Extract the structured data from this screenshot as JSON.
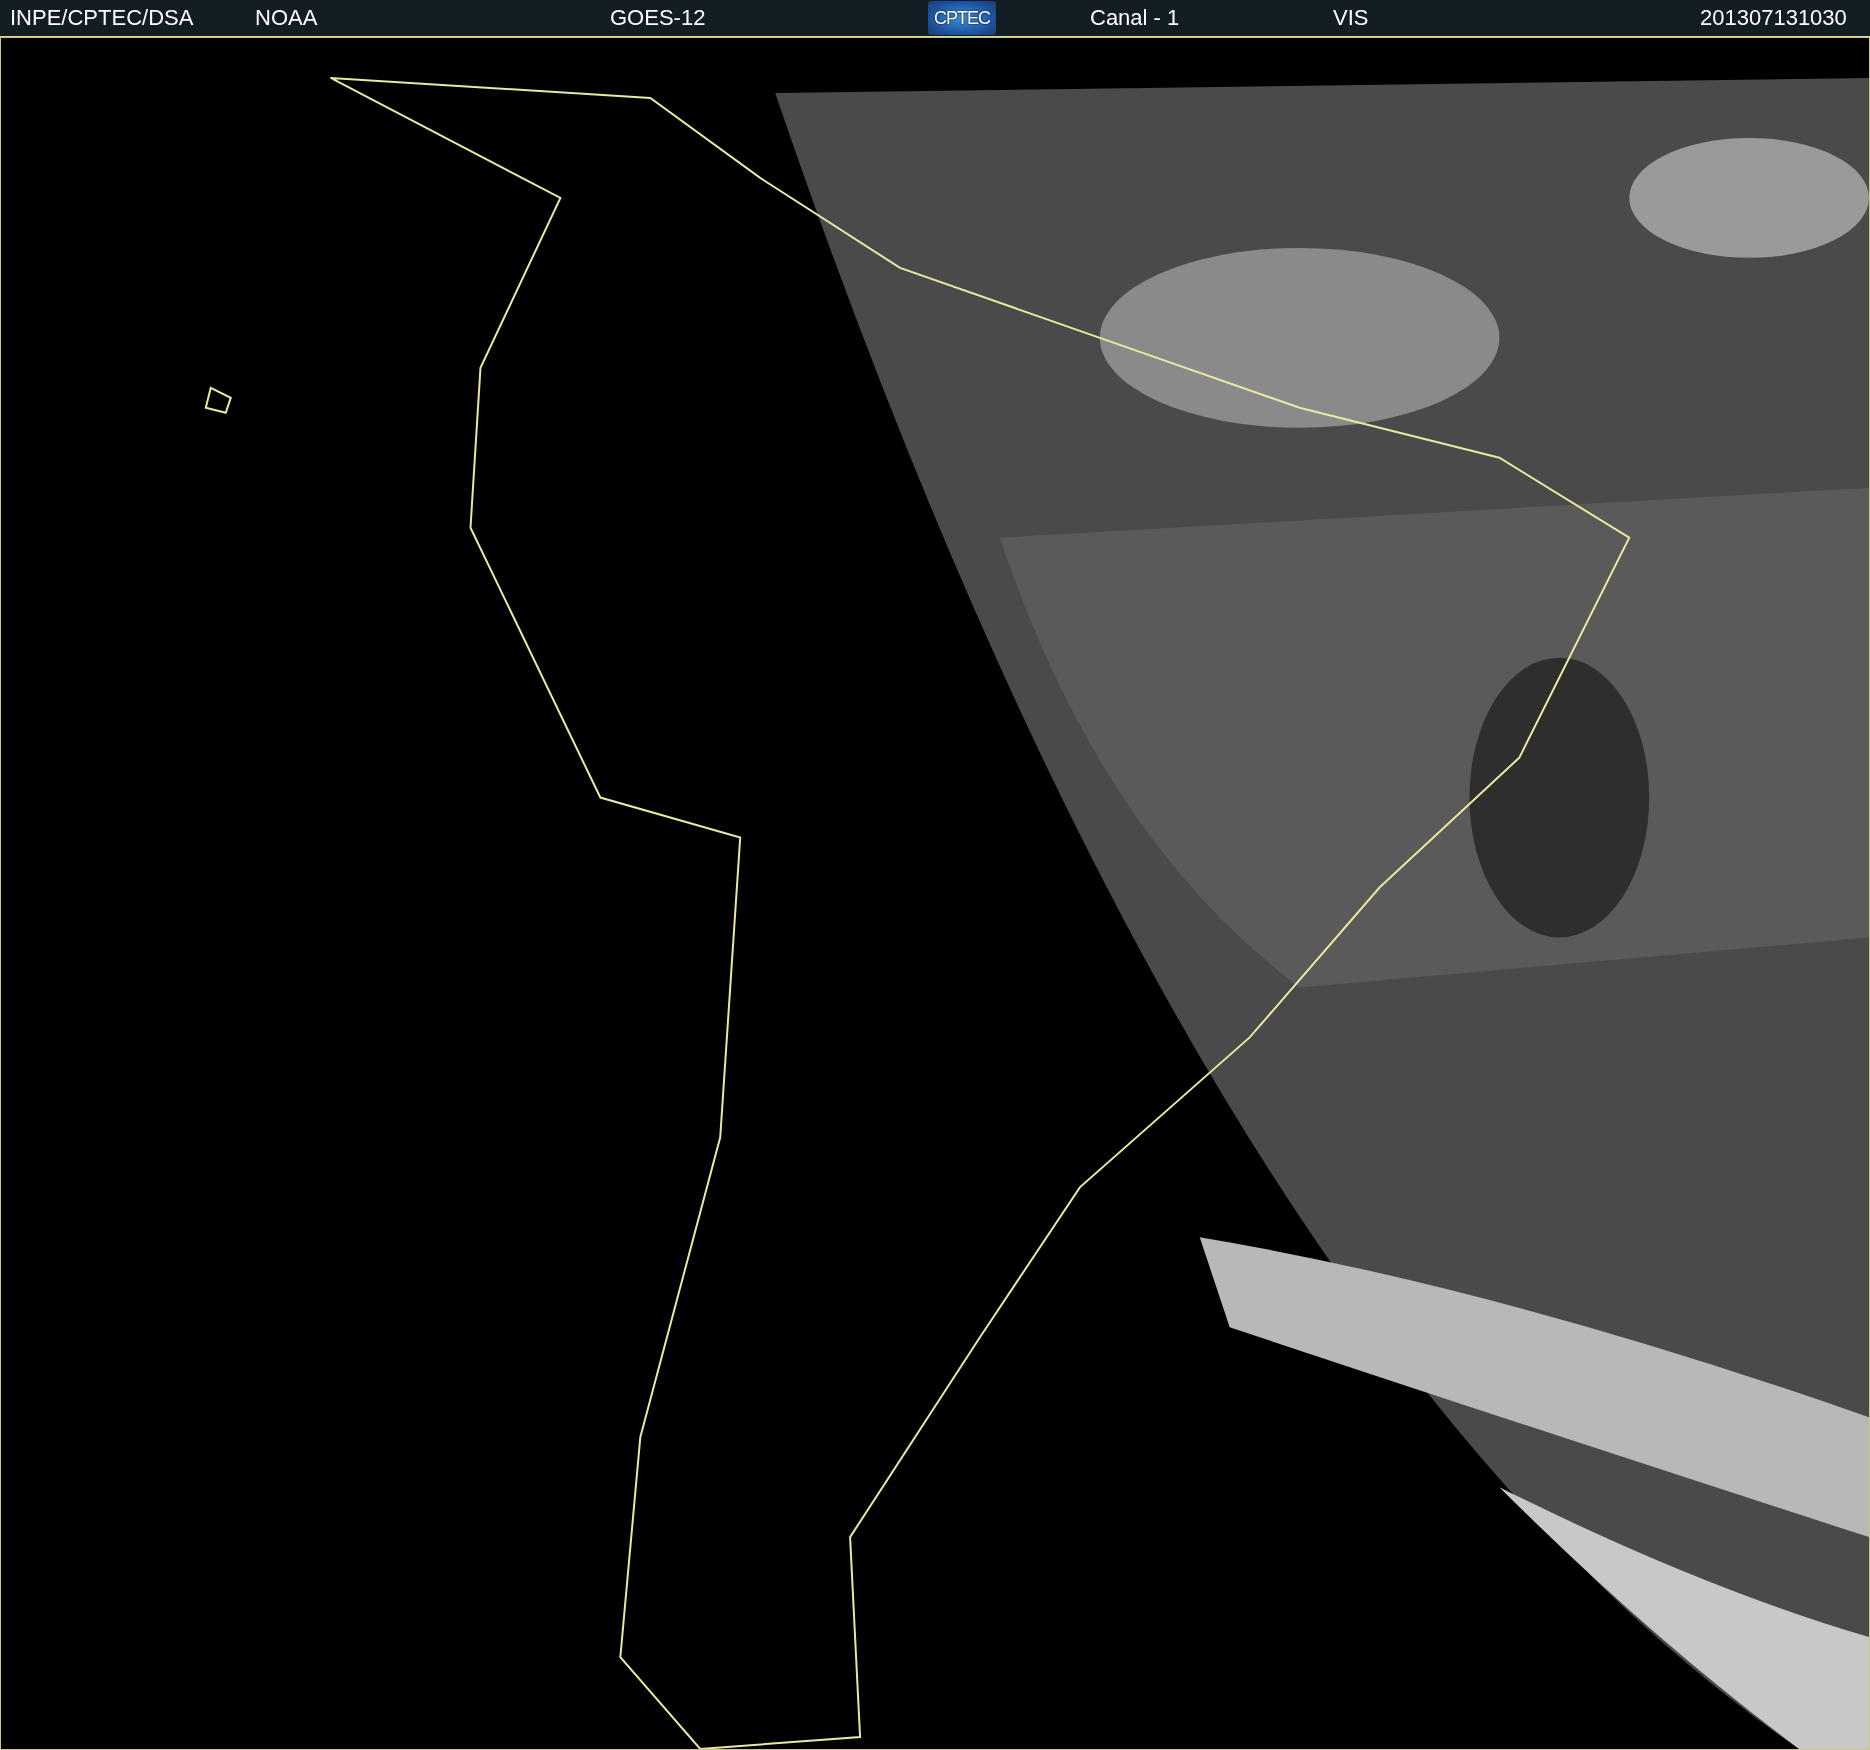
{
  "header": {
    "source": "INPE/CPTEC/DSA",
    "agency": "NOAA",
    "satellite": "GOES-12",
    "logo_text": "CPTEC",
    "channel": "Canal - 1",
    "band": "VIS",
    "timestamp": "201307131030"
  }
}
